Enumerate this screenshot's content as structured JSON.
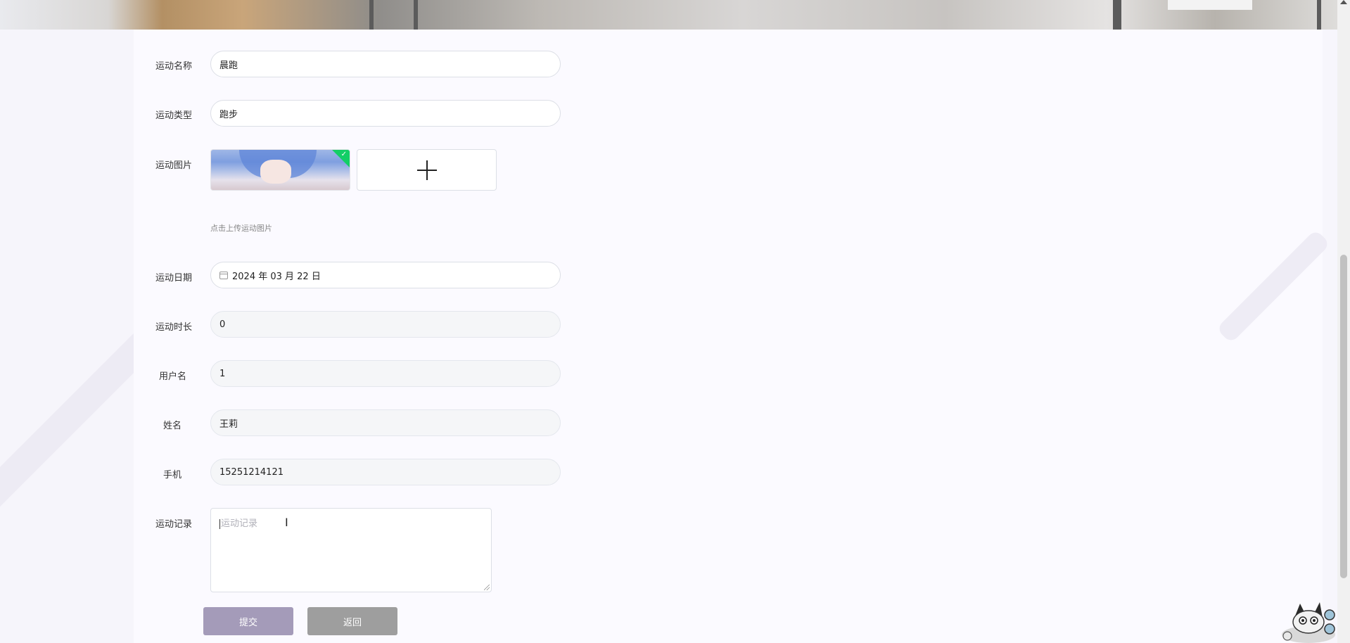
{
  "form": {
    "name": {
      "label": "运动名称",
      "value": "晨跑"
    },
    "type": {
      "label": "运动类型",
      "value": "跑步"
    },
    "image": {
      "label": "运动图片",
      "hint": "点击上传运动图片"
    },
    "date": {
      "label": "运动日期",
      "value": "2024 年 03 月 22 日"
    },
    "duration": {
      "label": "运动时长",
      "value": "0"
    },
    "username": {
      "label": "用户名",
      "value": "1"
    },
    "realname": {
      "label": "姓名",
      "value": "王莉"
    },
    "phone": {
      "label": "手机",
      "value": "15251214121"
    },
    "record": {
      "label": "运动记录",
      "placeholder": "运动记录"
    }
  },
  "buttons": {
    "submit": "提交",
    "back": "返回"
  },
  "colors": {
    "submit": "#a49bb9",
    "back": "#9e9e9e",
    "upload_success": "#13ce66"
  }
}
